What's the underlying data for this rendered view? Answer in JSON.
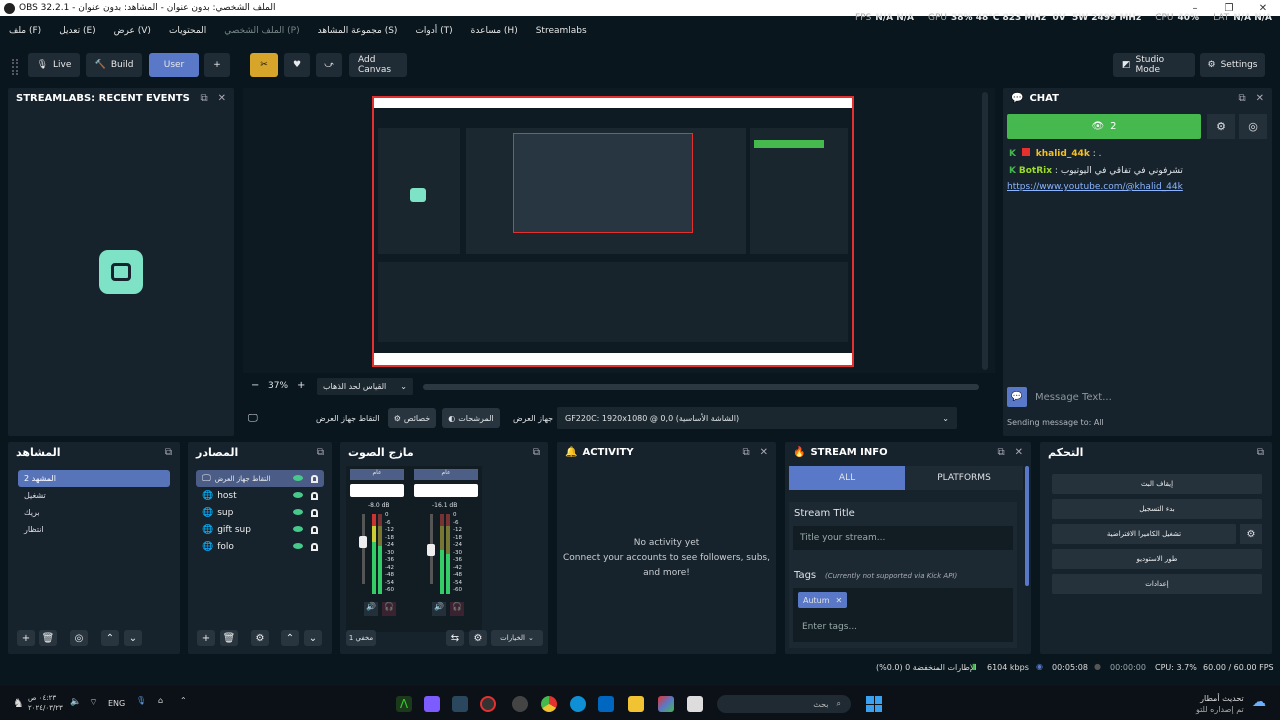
{
  "window": {
    "title": "OBS 32.2.1 - الملف الشخصي: بدون عنوان - المشاهد: بدون عنوان"
  },
  "menu": {
    "items": [
      "ملف (F)",
      "تعديل (E)",
      "عرض (V)",
      "المحتويات",
      "الملف الشخصي (P)",
      "مجموعة المشاهد (S)",
      "أدوات (T)",
      "مساعدة (H)",
      "Streamlabs"
    ]
  },
  "stats": {
    "fps_label": "FPS",
    "fps1": "N/A",
    "fps2": "N/A",
    "gpu_label": "GPU",
    "gpu": "38%",
    "gpu_temp": "48°C",
    "gpu_clock": "823 MHz",
    "volt": "0V",
    "watt": "5W",
    "mem_clock": "2499 MHz",
    "cpu_label": "CPU",
    "cpu": "40%",
    "lat_label": "LAT",
    "lat1": "N/A",
    "lat2": "N/A"
  },
  "toolbar": {
    "live": "Live",
    "build": "Build",
    "user": "User",
    "plus": "+",
    "add_canvas": "Add Canvas",
    "studio_mode": "Studio Mode",
    "settings": "Settings"
  },
  "recent_events": {
    "title": "STREAMLABS: RECENT EVENTS"
  },
  "preview": {
    "zoom": "37%",
    "zoom_minus": "−",
    "zoom_plus": "+",
    "scale_mode": "القياس لحد الذهاب"
  },
  "source_bar": {
    "source_label": "التقاط جهاز العرض",
    "properties": "خصائص",
    "filters": "المرشحات",
    "display_label": "جهاز العرض",
    "display_value": "GF220C: 1920x1080 @ 0,0 (الشاشة الأساسية)"
  },
  "chat": {
    "title": "CHAT",
    "viewers": "2",
    "messages": [
      {
        "user": "khalid_44k",
        "text": ": ."
      },
      {
        "user": "BotRix",
        "text": ": تشرفوني في تفاقي في اليوتيوب"
      }
    ],
    "link": "https://www.youtube.com/@khalid_44k",
    "placeholder": "Message Text...",
    "sending_to": "Sending message to: All"
  },
  "scenes": {
    "title": "المشاهد",
    "items": [
      "المشهد 2",
      "تشغيل",
      "بريك",
      "انتظار"
    ]
  },
  "sources": {
    "title": "المصادر",
    "items": [
      "التقاط جهاز العرض",
      "host",
      "sup",
      "gift sup",
      "folo"
    ]
  },
  "mixer": {
    "title": "مازج الصوت",
    "ch1_db": "-8.0 dB",
    "ch2_db": "-16.1 dB",
    "ch1_name": "عام",
    "ch2_name": "عام",
    "scale": [
      "0",
      "-6",
      "-12",
      "-18",
      "-24",
      "-30",
      "-36",
      "-42",
      "-48",
      "-54",
      "-60"
    ],
    "bottom_left": "مخفي 1",
    "bottom_right": "الخيارات"
  },
  "activity": {
    "title": "ACTIVITY",
    "line1": "No activity yet",
    "line2": "Connect your accounts to see followers, subs,",
    "line3": "and more!"
  },
  "stream_info": {
    "title": "STREAM INFO",
    "tab_all": "ALL",
    "tab_platforms": "PLATFORMS",
    "stream_title_label": "Stream Title",
    "title_placeholder": "Title your stream...",
    "tags_label": "Tags",
    "tags_note": "(Currently not supported via Kick API)",
    "tag": "Autum",
    "tags_placeholder": "Enter tags..."
  },
  "controls": {
    "title": "التحكم",
    "buttons": [
      "إيقاف البث",
      "بدء التسجيل",
      "تشغيل الكاميرا الافتراضية",
      "طور الاستوديو",
      "إعدادات"
    ]
  },
  "status": {
    "dropped": "الإطارات المنخفضة 0 (0.0%)",
    "kbps": "6104 kbps",
    "live_time": "00:05:08",
    "rec_time": "00:00:00",
    "cpu": "CPU: 3.7%",
    "fps": "60.00 / 60.00 FPS"
  },
  "taskbar": {
    "time": "٠٤:٢٣ ص",
    "date": "٢٠٢٤/٠٣/٢٣",
    "lang": "ENG",
    "search": "بحث",
    "update1": "تحديث أمطار",
    "update2": "تم إصداره للتو"
  },
  "colors": {
    "accent": "#5a78c8",
    "green": "#45b84e",
    "red": "#e53030"
  }
}
